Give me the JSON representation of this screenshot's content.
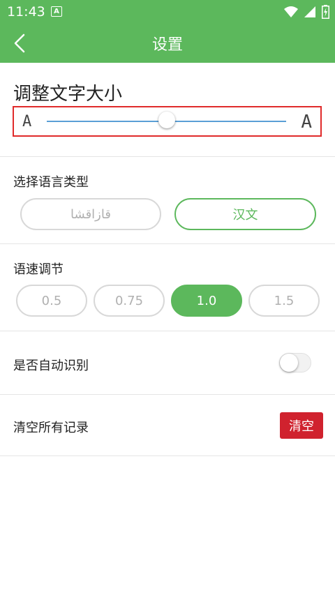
{
  "status_bar": {
    "time": "11:43",
    "notification_glyph": "A",
    "icons": [
      "wifi-icon",
      "signal-icon",
      "battery-charging-icon"
    ]
  },
  "header": {
    "title": "设置",
    "back_icon": "chevron-left-icon",
    "color": "#5cb85c"
  },
  "font_size": {
    "title": "调整文字大小",
    "small_glyph": "A",
    "large_glyph": "A",
    "level": 0.5
  },
  "language": {
    "title": "选择语言类型",
    "options": [
      {
        "label": "قازاقشا",
        "selected": false
      },
      {
        "label": "汉文",
        "selected": true
      }
    ]
  },
  "speech_speed": {
    "title": "语速调节",
    "options": [
      {
        "label": "0.5",
        "selected": false
      },
      {
        "label": "0.75",
        "selected": false
      },
      {
        "label": "1.0",
        "selected": true
      },
      {
        "label": "1.5",
        "selected": false
      }
    ]
  },
  "auto_detect": {
    "label": "是否自动识别",
    "enabled": false
  },
  "clear_records": {
    "label": "清空所有记录",
    "button_label": "清空",
    "button_color": "#d0222e"
  }
}
